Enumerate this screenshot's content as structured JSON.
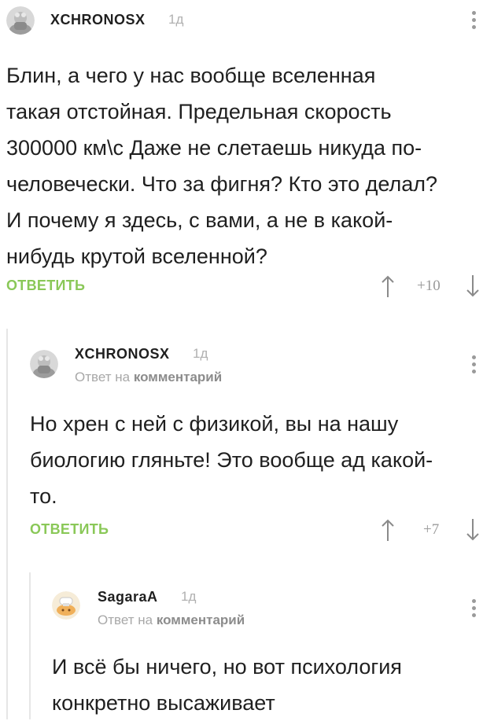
{
  "comments": [
    {
      "username": "XCHRONOSX",
      "time": "1д",
      "text": "Блин, а чего у нас вообще вселенная такая отстойная. Предельная скорость 300000 км\\с Даже не слетаешь никуда по-человечески. Что за фигня? Кто это делал? И почему я здесь, с вами, а не в какой-нибудь крутой вселенной?",
      "lines": [
        "Блин, а чего у нас вообще вселенная",
        "такая отстойная. Предельная скорость",
        "300000 км\\с Даже не слетаешь никуда по-",
        "человечески. Что за фигня? Кто это делал?",
        "И почему я здесь, с вами, а не в какой-",
        "нибудь крутой вселенной?"
      ],
      "reply_label": "ОТВЕТИТЬ",
      "rating": "+10"
    },
    {
      "username": "XCHRONOSX",
      "time": "1д",
      "reply_prefix": "Ответ на",
      "reply_target": "комментарий",
      "lines": [
        "Но хрен с ней с физикой, вы на нашу",
        "биологию гляньте! Это вообще ад какой-",
        "то."
      ],
      "reply_label": "ОТВЕТИТЬ",
      "rating": "+7"
    },
    {
      "username": "SagaraA",
      "time": "1д",
      "reply_prefix": "Ответ на",
      "reply_target": "комментарий",
      "lines": [
        "И всё бы ничего, но вот психология",
        "конкретно высаживает"
      ]
    }
  ],
  "icons": {
    "vote_up": "arrow-up-icon",
    "vote_down": "arrow-down-icon",
    "more": "more-vertical-icon"
  },
  "colors": {
    "reply_button": "#8ac858",
    "thread_line": "#e6e6e6",
    "muted_text": "#a8a8a8"
  }
}
